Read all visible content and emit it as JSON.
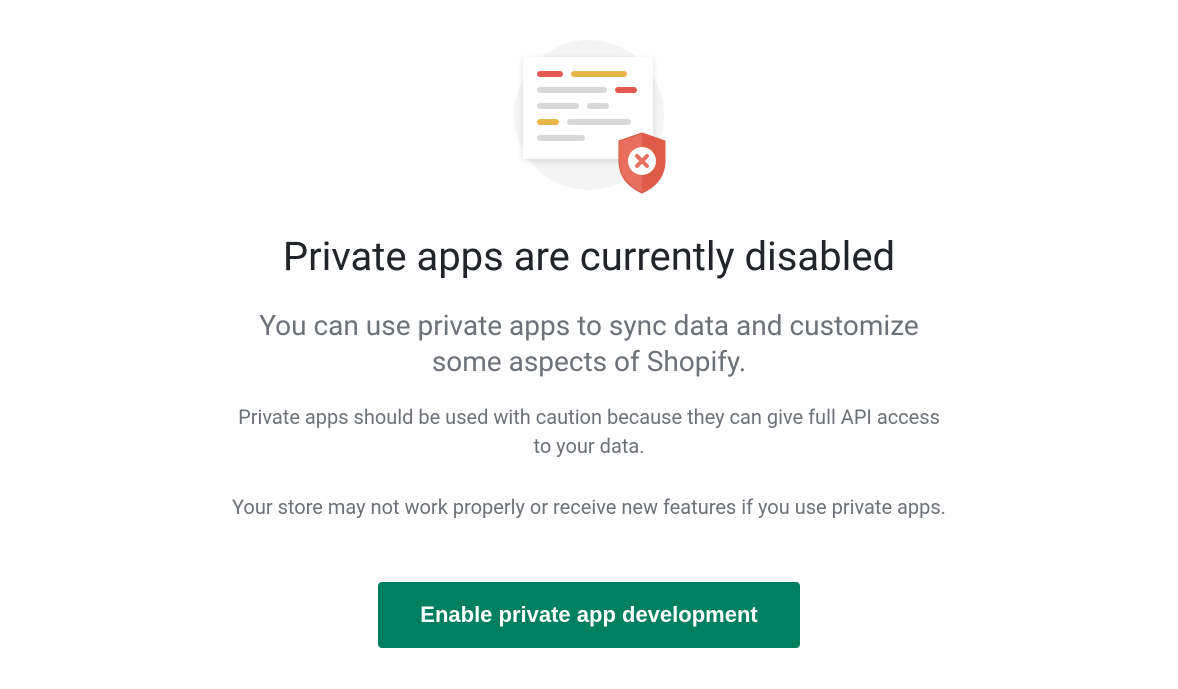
{
  "heading": "Private apps are currently disabled",
  "subheading": "You can use private apps to sync data and customize some aspects of Shopify.",
  "body1": "Private apps should be used with caution because they can give full API access to your data.",
  "body2": "Your store may not work properly or receive new features if you use private apps.",
  "cta_label": "Enable private app development",
  "colors": {
    "accent_red": "#e55a4e",
    "accent_yellow": "#eab54a",
    "accent_gray": "#d8d8d8",
    "button_bg": "#008060"
  }
}
